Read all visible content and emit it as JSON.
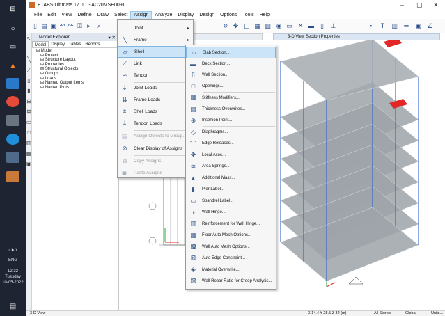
{
  "taskbar": {
    "icons": [
      "windows-start-icon",
      "search-icon",
      "task-view-icon",
      "vlc-icon",
      "files-icon",
      "chrome-icon",
      "app-icon",
      "edge-icon",
      "app-icon",
      "etabs-taskbar-icon"
    ],
    "time": "12:32",
    "day": "Tuesday",
    "date": "10-05-2022",
    "lang": "ENG"
  },
  "window": {
    "title": "ETABS Ultimate 17.0.1 - AC20MSE0091",
    "menus": [
      "File",
      "Edit",
      "View",
      "Define",
      "Draw",
      "Select",
      "Assign",
      "Analyze",
      "Display",
      "Design",
      "Options",
      "Tools",
      "Help"
    ],
    "active_menu": "Assign"
  },
  "explorer": {
    "title": "Model Explorer",
    "tabs": [
      "Model",
      "Display",
      "Tables",
      "Reports"
    ],
    "tree": [
      "Model",
      "Project",
      "Structure Layout",
      "Properties",
      "Structural Objects",
      "Groups",
      "Loads",
      "Named Output Items",
      "Named Plots"
    ]
  },
  "view_tabs": {
    "tab2": "3-D View  Section Properties"
  },
  "assign_menu": [
    {
      "label": "Joint",
      "icon": "joint-icon",
      "arrow": true
    },
    {
      "label": "Frame",
      "icon": "frame-icon",
      "arrow": true
    },
    {
      "label": "Shell",
      "icon": "shell-icon",
      "arrow": true,
      "highlight": true
    },
    {
      "label": "Link",
      "icon": "link-icon",
      "arrow": true
    },
    {
      "label": "Tendon",
      "icon": "tendon-icon",
      "arrow": true
    },
    {
      "label": "Joint Loads",
      "icon": "joint-loads-icon",
      "arrow": true
    },
    {
      "label": "Frame Loads",
      "icon": "frame-loads-icon",
      "arrow": true
    },
    {
      "label": "Shell Loads",
      "icon": "shell-loads-icon",
      "arrow": true
    },
    {
      "label": "Tendon Loads",
      "icon": "tendon-loads-icon",
      "arrow": true
    },
    {
      "label": "Assign Objects to Group...",
      "icon": "group-icon",
      "disabled": true
    },
    {
      "label": "Clear Display of Assigns",
      "icon": "clear-icon"
    },
    {
      "label": "Copy Assigns",
      "icon": "copy-icon",
      "disabled": true
    },
    {
      "label": "Paste Assigns",
      "icon": "paste-icon",
      "arrow": true,
      "disabled": true
    }
  ],
  "shell_menu": [
    {
      "label": "Slab Section...",
      "icon": "slab-section-icon",
      "highlight": true
    },
    {
      "label": "Deck Section...",
      "icon": "deck-section-icon"
    },
    {
      "label": "Wall Section...",
      "icon": "wall-section-icon"
    },
    {
      "label": "Openings...",
      "icon": "openings-icon"
    },
    {
      "label": "Stiffness Modifiers...",
      "icon": "stiffness-icon"
    },
    {
      "label": "Thickness Overwrites...",
      "icon": "thickness-icon"
    },
    {
      "label": "Insertion Point...",
      "icon": "insertion-icon"
    },
    {
      "label": "Diaphragms...",
      "icon": "diaphragm-icon"
    },
    {
      "label": "Edge Releases...",
      "icon": "edge-release-icon"
    },
    {
      "label": "Local Axes...",
      "icon": "local-axes-icon"
    },
    {
      "label": "Area Springs...",
      "icon": "area-springs-icon"
    },
    {
      "label": "Additional Mass...",
      "icon": "additional-mass-icon"
    },
    {
      "label": "Pier Label...",
      "icon": "pier-label-icon"
    },
    {
      "label": "Spandrel Label...",
      "icon": "spandrel-label-icon"
    },
    {
      "label": "Wall Hinge...",
      "icon": "wall-hinge-icon"
    },
    {
      "label": "Reinforcement for Wall Hinge...",
      "icon": "reinforcement-icon"
    },
    {
      "label": "Floor Auto Mesh Options...",
      "icon": "floor-mesh-icon"
    },
    {
      "label": "Wall Auto Mesh Options...",
      "icon": "wall-mesh-icon"
    },
    {
      "label": "Auto Edge Constraint...",
      "icon": "edge-constraint-icon"
    },
    {
      "label": "Material Overwrite...",
      "icon": "material-icon"
    },
    {
      "label": "Wall Rebar Ratio for Creep Analysis...",
      "icon": "rebar-ratio-icon"
    }
  ],
  "status": {
    "left": "3-D View",
    "coords": "X 14.4  Y 25.5  Z 32 (m)",
    "stories": "All Stories",
    "system": "Global",
    "units": "Units..."
  },
  "colors": {
    "highlight": "#cce4f7",
    "slab_fill": "#9ea3a9",
    "frame_blue": "#2f64c8",
    "load_red": "#e32626",
    "axis_green": "#2fa33a"
  }
}
